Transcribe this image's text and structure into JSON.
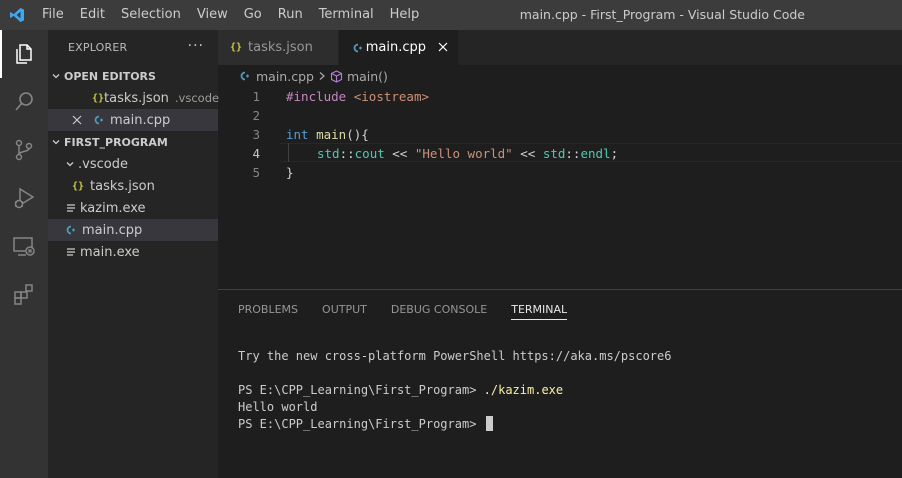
{
  "titlebar": {
    "menu": [
      "File",
      "Edit",
      "Selection",
      "View",
      "Go",
      "Run",
      "Terminal",
      "Help"
    ],
    "window_title": "main.cpp - First_Program - Visual Studio Code"
  },
  "activitybar": {
    "icons": [
      "explorer-icon",
      "search-icon",
      "source-control-icon",
      "run-debug-icon",
      "remote-explorer-icon",
      "extensions-icon"
    ]
  },
  "sidebar": {
    "title": "EXPLORER",
    "more": "···",
    "open_editors": {
      "label": "OPEN EDITORS",
      "items": [
        {
          "name": "tasks.json",
          "desc": ".vscode"
        },
        {
          "name": "main.cpp",
          "desc": ""
        }
      ]
    },
    "folder": {
      "label": "FIRST_PROGRAM",
      "items": [
        {
          "name": ".vscode"
        },
        {
          "name": "tasks.json"
        },
        {
          "name": "kazim.exe"
        },
        {
          "name": "main.cpp"
        },
        {
          "name": "main.exe"
        }
      ]
    }
  },
  "tabs": [
    {
      "label": "tasks.json"
    },
    {
      "label": "main.cpp"
    }
  ],
  "breadcrumb": {
    "file": "main.cpp",
    "symbol": "main()"
  },
  "editor": {
    "line_numbers": [
      "1",
      "2",
      "3",
      "4",
      "5"
    ],
    "lines": {
      "l1_directive": "#include",
      "l1_header": " <iostream>",
      "l3_type": "int",
      "l3_func": " main",
      "l3_rest": "(){",
      "l4_ns1": "std",
      "l4_sep1": "::",
      "l4_cout": "cout",
      "l4_op1": " << ",
      "l4_str": "\"Hello world\"",
      "l4_op2": " << ",
      "l4_ns2": "std",
      "l4_sep2": "::",
      "l4_endl": "endl",
      "l4_end": ";",
      "l5": "}"
    }
  },
  "panel": {
    "tabs": [
      "PROBLEMS",
      "OUTPUT",
      "DEBUG CONSOLE",
      "TERMINAL"
    ],
    "terminal": {
      "line1": "Try the new cross-platform PowerShell https://aka.ms/pscore6",
      "prompt1": "PS E:\\CPP_Learning\\First_Program> ",
      "cmd1": "./kazim.exe",
      "output1": "Hello world",
      "prompt2": "PS E:\\CPP_Learning\\First_Program> "
    }
  }
}
